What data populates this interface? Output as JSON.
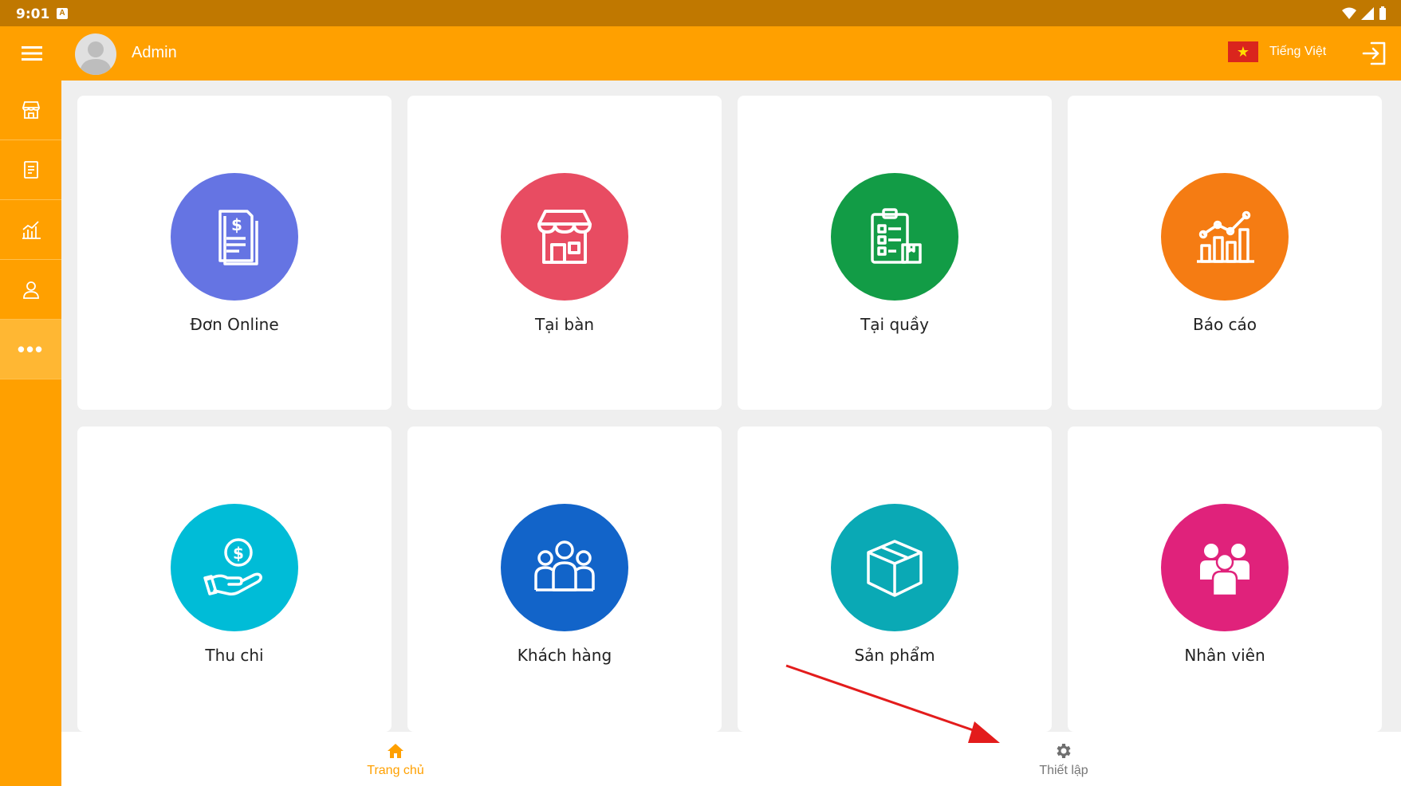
{
  "status_bar": {
    "time": "9:01",
    "notification_glyph": "A"
  },
  "header": {
    "user_name": "Admin",
    "language_label": "Tiếng Việt",
    "icons": [
      "menu-icon",
      "avatar",
      "vn-flag-icon",
      "logout-icon"
    ]
  },
  "side_rail": {
    "items": [
      {
        "icon": "store-icon"
      },
      {
        "icon": "invoice-icon"
      },
      {
        "icon": "report-chart-icon"
      },
      {
        "icon": "user-icon"
      },
      {
        "icon": "more-icon",
        "glyph": "•••"
      }
    ]
  },
  "tiles": [
    {
      "label": "Đơn Online",
      "color": "#6574e3",
      "icon": "document-dollar-icon"
    },
    {
      "label": "Tại bàn",
      "color": "#e84c62",
      "icon": "storefront-icon"
    },
    {
      "label": "Tại quầy",
      "color": "#129c46",
      "icon": "clipboard-box-icon"
    },
    {
      "label": "Báo cáo",
      "color": "#f57c13",
      "icon": "chart-up-icon"
    },
    {
      "label": "Thu chi",
      "color": "#00bcd7",
      "icon": "hand-coin-icon"
    },
    {
      "label": "Khách hàng",
      "color": "#1264c9",
      "icon": "customers-group-icon"
    },
    {
      "label": "Sản phẩm",
      "color": "#0aa9b5",
      "icon": "box-icon"
    },
    {
      "label": "Nhân viên",
      "color": "#e0227b",
      "icon": "staff-group-icon"
    }
  ],
  "bottom_nav": {
    "home_label": "Trang chủ",
    "settings_label": "Thiết lập"
  },
  "colors": {
    "primary": "#ffa000",
    "status_bar": "#c07800",
    "annotation_arrow": "#e31c1c"
  }
}
